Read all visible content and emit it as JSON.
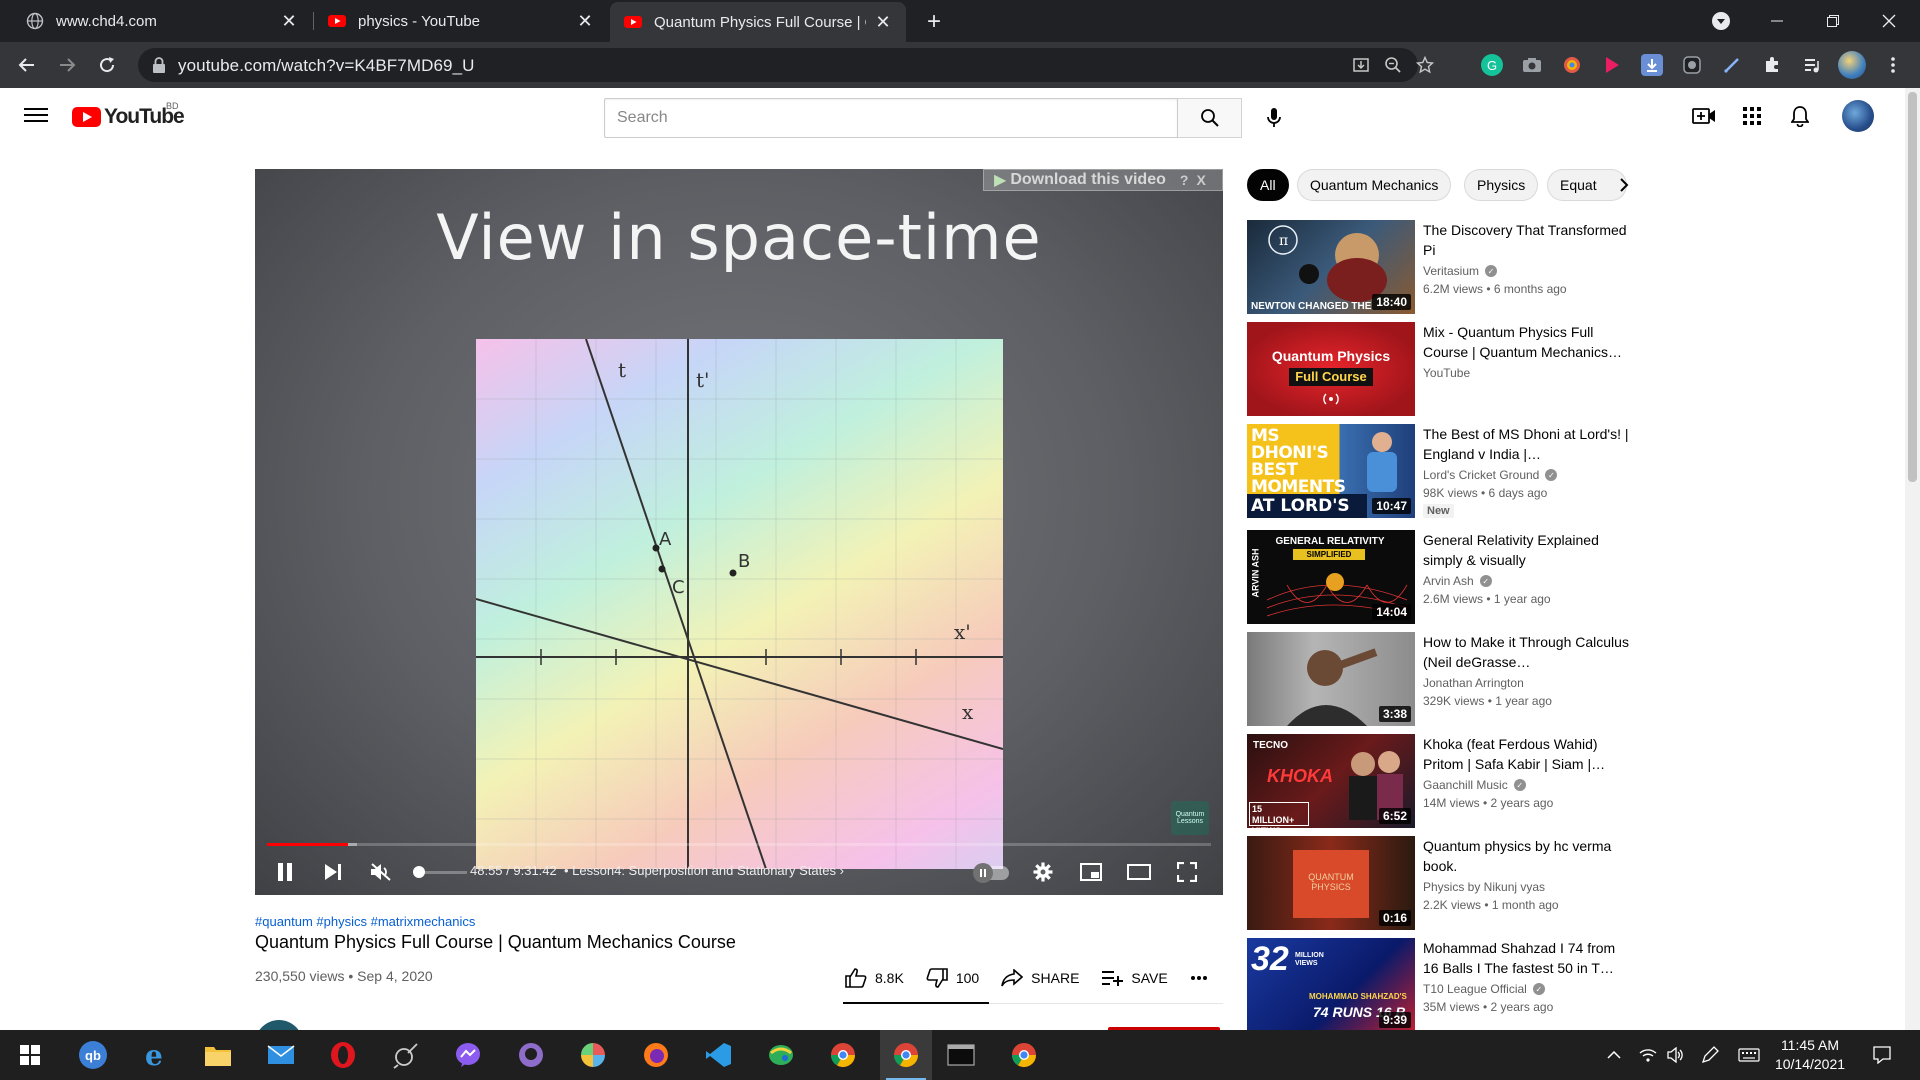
{
  "browser": {
    "tabs": [
      {
        "title": "www.chd4.com",
        "icon": "globe-icon",
        "active": false
      },
      {
        "title": "physics - YouTube",
        "icon": "youtube-icon",
        "active": false
      },
      {
        "title": "Quantum Physics Full Course | Qu",
        "icon": "youtube-icon",
        "active": true
      }
    ],
    "url": "youtube.com/watch?v=K4BF7MD69_U"
  },
  "youtube": {
    "logo_text": "YouTube",
    "country_code": "BD",
    "search_placeholder": "Search"
  },
  "player": {
    "slide_title": "View in space-time",
    "download_banner": "Download this video",
    "download_banner_help": "?",
    "download_banner_close": "X",
    "time_display": "48:55 / 9:31:42",
    "chapter": "• Lesson4: Superposition and Stationary States",
    "played_fraction": 0.086,
    "loaded_fraction": 0.095,
    "diagram_labels": {
      "t": "t",
      "t_prime": "t'",
      "a": "A",
      "b": "B",
      "c": "C",
      "x": "x",
      "x_prime": "x'"
    },
    "watermark": "Quantum Lessons"
  },
  "video": {
    "hashtags": "#quantum #physics #matrixmechanics",
    "title": "Quantum Physics Full Course | Quantum Mechanics Course",
    "meta": "230,550 views • Sep 4, 2020",
    "likes": "8.8K",
    "dislikes": "100",
    "share_label": "SHARE",
    "save_label": "SAVE"
  },
  "chips": [
    "All",
    "Quantum Mechanics",
    "Physics",
    "Equat"
  ],
  "recommendations": [
    {
      "title": "The Discovery That Transformed Pi",
      "channel": "Veritasium",
      "verified": true,
      "stats": "6.2M views • 6 months ago",
      "duration": "18:40",
      "thumb_text": "NEWTON CHANGED THE"
    },
    {
      "title": "Mix - Quantum Physics Full Course | Quantum Mechanics…",
      "channel": "YouTube",
      "verified": false,
      "stats": "",
      "duration": "",
      "thumb_text": "Quantum Physics",
      "thumb_text2": "Full Course"
    },
    {
      "title": "The Best of MS Dhoni at Lord's! | England v India |…",
      "channel": "Lord's Cricket Ground",
      "verified": true,
      "stats": "98K views • 6 days ago",
      "duration": "10:47",
      "badge": "New",
      "thumb_text": "MS DHONI'S BEST MOMENTS",
      "thumb_text2": "AT LORD'S"
    },
    {
      "title": "General Relativity Explained simply & visually",
      "channel": "Arvin Ash",
      "verified": true,
      "stats": "2.6M views • 1 year ago",
      "duration": "14:04",
      "thumb_text": "GENERAL RELATIVITY",
      "thumb_text2": "SIMPLIFIED",
      "thumb_text3": "ARVIN ASH"
    },
    {
      "title": "How to Make it Through Calculus (Neil deGrasse…",
      "channel": "Jonathan Arrington",
      "verified": false,
      "stats": "329K views • 1 year ago",
      "duration": "3:38"
    },
    {
      "title": "Khoka (feat Ferdous Wahid) Pritom | Safa Kabir | Siam |…",
      "channel": "Gaanchill Music",
      "verified": true,
      "stats": "14M views • 2 years ago",
      "duration": "6:52",
      "thumb_text": "TECNO",
      "thumb_text2": "KHOKA",
      "thumb_text3": "15 MILLION+ VIEWS"
    },
    {
      "title": "Quantum physics by hc verma book.",
      "channel": "Physics by Nikunj vyas",
      "verified": false,
      "stats": "2.2K views • 1 month ago",
      "duration": "0:16",
      "thumb_text": "QUANTUM PHYSICS"
    },
    {
      "title": "Mohammad Shahzad I 74 from 16 Balls I The fastest 50 in T…",
      "channel": "T10 League Official",
      "verified": true,
      "stats": "35M views • 2 years ago",
      "duration": "9:39",
      "thumb_text": "32",
      "thumb_text2": "MILLION VIEWS",
      "thumb_text3": "MOHAMMAD SHAHZAD'S",
      "thumb_text4": "74 RUNS 16 B"
    }
  ],
  "taskbar": {
    "time": "11:45 AM",
    "date": "10/14/2021"
  },
  "colors": {
    "yt_red": "#ff0000",
    "chrome_dark": "#202124",
    "chrome_toolbar": "#35363a",
    "link_blue": "#065fd4"
  }
}
